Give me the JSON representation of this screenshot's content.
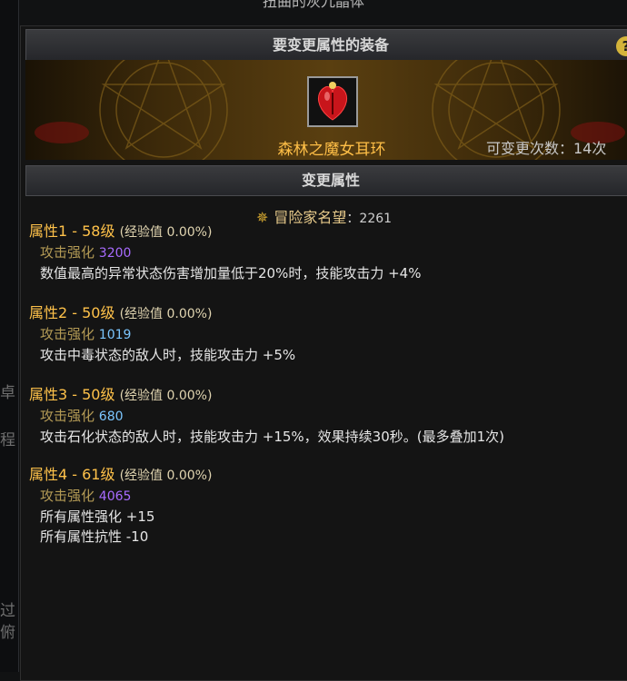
{
  "window": {
    "top_title": "扭曲的灰九晶体",
    "left_chars": [
      "卓",
      "程",
      "过",
      "俯"
    ]
  },
  "header": {
    "title": "要变更属性的装备",
    "help_icon": "?"
  },
  "item": {
    "name": "森林之魔女耳环",
    "icon": "red-earring-icon",
    "change_count": "可变更次数：14次"
  },
  "section": {
    "title": "变更属性"
  },
  "fame": {
    "label": "冒险家名望",
    "value": "：2261"
  },
  "attributes": [
    {
      "title": "属性1 - 58级",
      "exp": "(经验值 0.00%)",
      "stat_label": "攻击强化",
      "stat_value": "3200",
      "lines": [
        "数值最高的异常状态伤害增加量低于20%时，技能攻击力 +4%"
      ]
    },
    {
      "title": "属性2 - 50级",
      "exp": "(经验值 0.00%)",
      "stat_label": "攻击强化",
      "stat_value": "1019",
      "lines": [
        "攻击中毒状态的敌人时，技能攻击力 +5%"
      ]
    },
    {
      "title": "属性3 - 50级",
      "exp": "(经验值 0.00%)",
      "stat_label": "攻击强化",
      "stat_value": "680",
      "lines": [
        "攻击石化状态的敌人时，技能攻击力 +15%，效果持续30秒。(最多叠加1次)"
      ]
    },
    {
      "title": "属性4 - 61级",
      "exp": "(经验值 0.00%)",
      "stat_label": "攻击强化",
      "stat_value": "4065",
      "lines": [
        "所有属性强化 +15",
        "所有属性抗性 -10"
      ]
    }
  ],
  "colors": {
    "gold": "#ffc24a",
    "purple_value": "#a86bff",
    "blue_value": "#7cc6ff"
  }
}
